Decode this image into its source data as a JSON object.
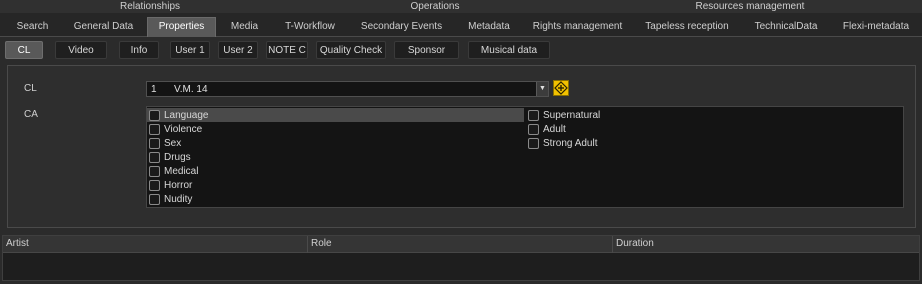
{
  "group_headers": [
    "Relationships",
    "Operations",
    "Resources management"
  ],
  "tabs": [
    {
      "label": "Search",
      "active": false
    },
    {
      "label": "General Data",
      "active": false
    },
    {
      "label": "Properties",
      "active": true
    },
    {
      "label": "Media",
      "active": false
    },
    {
      "label": "T-Workflow",
      "active": false
    },
    {
      "label": "Secondary Events",
      "active": false
    },
    {
      "label": "Metadata",
      "active": false
    },
    {
      "label": "Rights management",
      "active": false
    },
    {
      "label": "Tapeless reception",
      "active": false
    },
    {
      "label": "TechnicalData",
      "active": false
    },
    {
      "label": "Flexi-metadata",
      "active": false
    }
  ],
  "subtabs": [
    {
      "label": "CL",
      "active": true
    },
    {
      "label": "Video",
      "active": false
    },
    {
      "label": "Info",
      "active": false
    },
    {
      "label": "User 1",
      "active": false
    },
    {
      "label": "User 2",
      "active": false
    },
    {
      "label": "NOTE C",
      "active": false
    },
    {
      "label": "Quality Check",
      "active": false
    },
    {
      "label": "Sponsor",
      "active": false
    },
    {
      "label": "Musical data",
      "active": false
    }
  ],
  "form": {
    "cl_label": "CL",
    "cl_number": "1",
    "cl_value": "V.M. 14",
    "ca_label": "CA",
    "warn_icon": "warning-diamond-icon",
    "warn_color": "#f2c100"
  },
  "ca_items_left": [
    {
      "label": "Language",
      "checked": false,
      "highlighted": true
    },
    {
      "label": "Violence",
      "checked": false
    },
    {
      "label": "Sex",
      "checked": false
    },
    {
      "label": "Drugs",
      "checked": false
    },
    {
      "label": "Medical",
      "checked": false
    },
    {
      "label": "Horror",
      "checked": false
    },
    {
      "label": "Nudity",
      "checked": false
    }
  ],
  "ca_items_right": [
    {
      "label": "Supernatural",
      "checked": false
    },
    {
      "label": "Adult",
      "checked": false
    },
    {
      "label": "Strong Adult",
      "checked": false
    }
  ],
  "grid": {
    "columns": [
      "Artist",
      "Role",
      "Duration"
    ]
  }
}
